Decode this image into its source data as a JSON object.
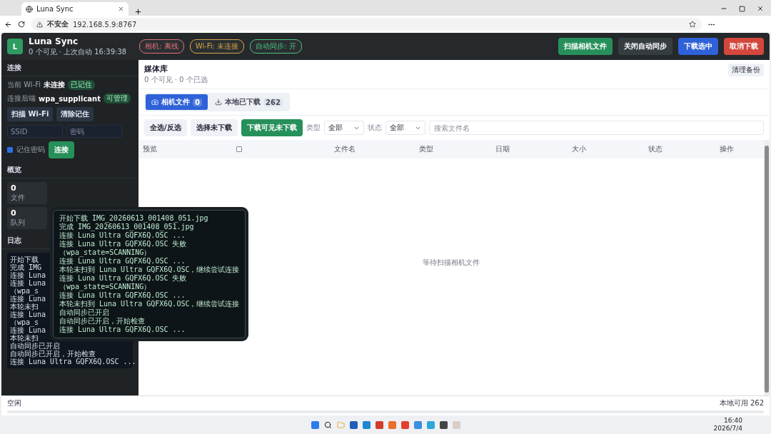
{
  "browser": {
    "tab_title": "Luna Sync",
    "security": "不安全",
    "url": "192.168.5.9:8767"
  },
  "header": {
    "logo": "L",
    "title": "Luna Sync",
    "subtitle": "0 个可见 · 上次自动 16:39:38",
    "badges": [
      {
        "label": "相机: 离线",
        "color": "#e0707a"
      },
      {
        "label": "Wi-Fi: 未连接",
        "color": "#d9a54a"
      },
      {
        "label": "自动同步: 开",
        "color": "#4cc585"
      }
    ],
    "buttons": [
      {
        "label": "扫描相机文件",
        "kind": "green"
      },
      {
        "label": "关闭自动同步",
        "kind": "dark"
      },
      {
        "label": "下载选中",
        "kind": "blue"
      },
      {
        "label": "取消下载",
        "kind": "red"
      }
    ]
  },
  "sidebar": {
    "connection": {
      "title": "连接",
      "wifi_label": "当前 Wi-Fi",
      "wifi_value": "未连接",
      "wifi_badge": "已记住",
      "backend_label": "连接后端",
      "backend_value": "wpa_supplicant",
      "backend_badge": "可管理",
      "buttons": [
        "扫描 Wi-Fi",
        "清除记住"
      ],
      "ssid_placeholder": "SSID",
      "password_placeholder": "密码",
      "remember": {
        "label": "记住密码",
        "checked": true
      },
      "connect": "连接"
    },
    "overview": {
      "title": "概览",
      "cards": [
        {
          "value": "0",
          "label": "文件"
        },
        {
          "value": "0",
          "label": "队列"
        }
      ]
    },
    "log": {
      "title": "日志",
      "lines": [
        "开始下载",
        "完成 IMG",
        "连接 Luna",
        "连接 Luna",
        "（wpa_s",
        "连接 Luna",
        "本轮未扫",
        "连接 Luna",
        "（wpa_s",
        "连接 Luna",
        "本轮未扫",
        "自动同步已开启",
        "自动同步已开启，开始检查",
        "连接 Luna Ultra GQFX6Q.OSC ..."
      ]
    }
  },
  "tooltip": {
    "lines": [
      "开始下载 IMG_20260613_001408_051.jpg",
      "完成 IMG_20260613_001408_051.jpg",
      "连接 Luna Ultra GQFX6Q.OSC ...",
      "连接 Luna Ultra GQFX6Q.OSC 失败",
      "（wpa_state=SCANNING）",
      "连接 Luna Ultra GQFX6Q.OSC ...",
      "本轮未扫到 Luna Ultra GQFX6Q.OSC，继续尝试连接",
      "连接 Luna Ultra GQFX6Q.OSC 失败",
      "（wpa_state=SCANNING）",
      "连接 Luna Ultra GQFX6Q.OSC ...",
      "本轮未扫到 Luna Ultra GQFX6Q.OSC，继续尝试连接",
      "自动同步已开启",
      "自动同步已开启，开始检查",
      "连接 Luna Ultra GQFX6Q.OSC ..."
    ]
  },
  "library": {
    "title": "媒体库",
    "subtitle": "0 个可见 · 0 个已选",
    "action": "清理备份",
    "tabs": [
      {
        "label": "相机文件",
        "count": "0",
        "selected": true
      },
      {
        "label": "本地已下载",
        "count": "262",
        "selected": false
      }
    ],
    "toolbar": {
      "buttons": [
        {
          "label": "全选/反选",
          "kind": "light"
        },
        {
          "label": "选择未下载",
          "kind": "light"
        },
        {
          "label": "下载可见未下载",
          "kind": "green"
        }
      ],
      "filters": [
        {
          "label": "类型",
          "value": "全部"
        },
        {
          "label": "状态",
          "value": "全部"
        }
      ],
      "search_placeholder": "搜索文件名"
    },
    "table": {
      "columns": [
        {
          "label": "预览",
          "kind": "text"
        },
        {
          "kind": "checkbox",
          "checked": false
        },
        {
          "label": "文件名",
          "kind": "text"
        },
        {
          "label": "类型",
          "kind": "text"
        },
        {
          "label": "日期",
          "kind": "text"
        },
        {
          "label": "大小",
          "kind": "text"
        },
        {
          "label": "状态",
          "kind": "text"
        },
        {
          "label": "操作",
          "kind": "text"
        }
      ],
      "empty": "等待扫描相机文件"
    }
  },
  "status_bar": {
    "status": "空闲",
    "level": 0,
    "info": "本地可用 262"
  },
  "taskbar": {
    "time": "16:40",
    "date": "2026/7/4"
  }
}
